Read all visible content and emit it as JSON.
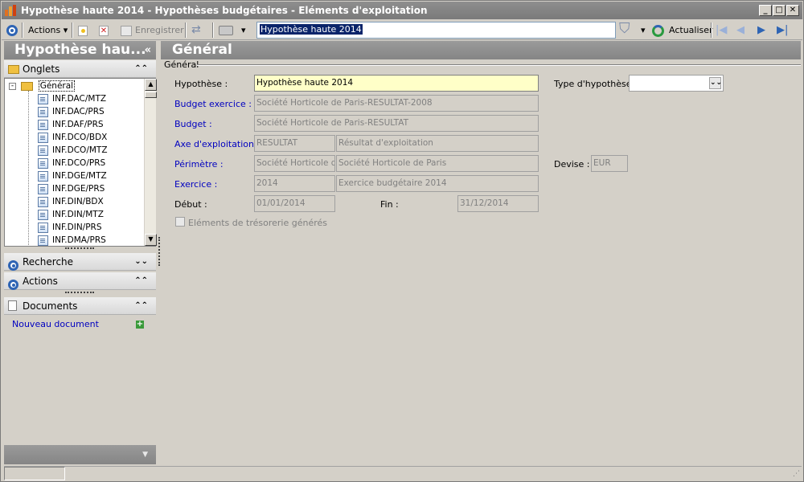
{
  "window": {
    "title": "Hypothèse haute 2014 -  Hypothèses budgétaires - Eléments d'exploitation"
  },
  "toolbar": {
    "actions_label": "Actions",
    "save_label": "Enregistrer",
    "search_value": "Hypothèse haute 2014",
    "refresh_label": "Actualiser"
  },
  "left": {
    "header_title": "Hypothèse hau...",
    "onglets_label": "Onglets",
    "tree_root": "Général",
    "tree_items": [
      "INF.DAC/MTZ",
      "INF.DAC/PRS",
      "INF.DAF/PRS",
      "INF.DCO/BDX",
      "INF.DCO/MTZ",
      "INF.DCO/PRS",
      "INF.DGE/MTZ",
      "INF.DGE/PRS",
      "INF.DIN/BDX",
      "INF.DIN/MTZ",
      "INF.DIN/PRS",
      "INF.DMA/PRS"
    ],
    "recherche_label": "Recherche",
    "actions_label": "Actions",
    "documents_label": "Documents",
    "new_document_label": "Nouveau document"
  },
  "main": {
    "header_title": "Général",
    "group_label": "Général",
    "fields": {
      "hypothese_label": "Hypothèse :",
      "hypothese_value": "Hypothèse haute 2014",
      "budget_exercice_label": "Budget exercice :",
      "budget_exercice_value": "Société Horticole de Paris-RESULTAT-2008",
      "budget_label": "Budget :",
      "budget_value": "Société Horticole de Paris-RESULTAT",
      "axe_label": "Axe d'exploitation :",
      "axe_code": "RESULTAT",
      "axe_value": "Résultat d'exploitation",
      "perimetre_label": "Périmètre :",
      "perimetre_code": "Société Horticole de",
      "perimetre_value": "Société Horticole de Paris",
      "exercice_label": "Exercice :",
      "exercice_code": "2014",
      "exercice_value": "Exercice budgétaire 2014",
      "debut_label": "Début :",
      "debut_value": "01/01/2014",
      "fin_label": "Fin :",
      "fin_value": "31/12/2014",
      "tresorerie_label": "Eléments de trésorerie générés",
      "type_label": "Type d'hypothèse :",
      "type_value": "",
      "devise_label": "Devise :",
      "devise_value": "EUR"
    }
  }
}
